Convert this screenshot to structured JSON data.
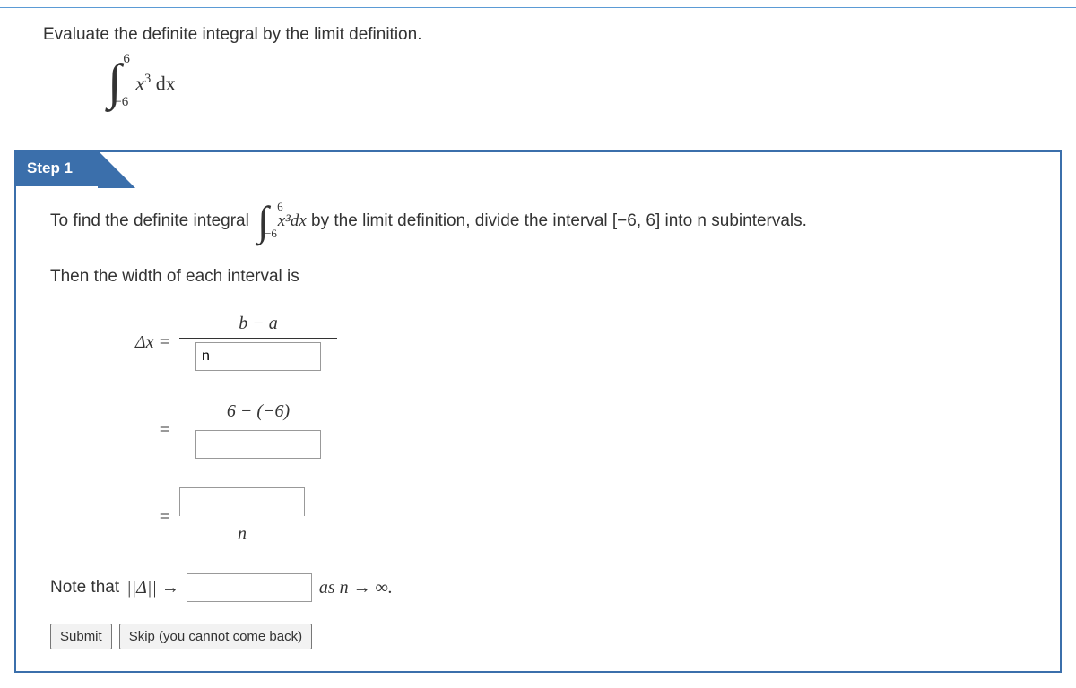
{
  "question": {
    "prompt": "Evaluate the definite integral by the limit definition.",
    "integral": {
      "upper": "6",
      "lower": "−6",
      "integrand_prefix": "x",
      "integrand_power": "3",
      "integrand_suffix": " dx"
    }
  },
  "step": {
    "label": "Step 1",
    "line1_prefix": "To find the definite integral ",
    "line1_integral": {
      "upper": "6",
      "lower": "−6",
      "body": "x³dx"
    },
    "line1_suffix": " by the limit definition, divide the interval [−6, 6] into n subintervals.",
    "line2": "Then the width of each interval is",
    "eq1": {
      "lhs": "Δx  =",
      "num": "b − a",
      "den_value": "n"
    },
    "eq2": {
      "lhs": "=",
      "num": "6 − (−6)",
      "den_value": ""
    },
    "eq3": {
      "lhs": "=",
      "num_value": "",
      "den": "n"
    },
    "note_prefix": "Note that ",
    "note_norm": "||Δ|| → ",
    "note_blank_value": "",
    "note_suffix": " as n → ∞."
  },
  "buttons": {
    "submit": "Submit",
    "skip": "Skip (you cannot come back)"
  }
}
